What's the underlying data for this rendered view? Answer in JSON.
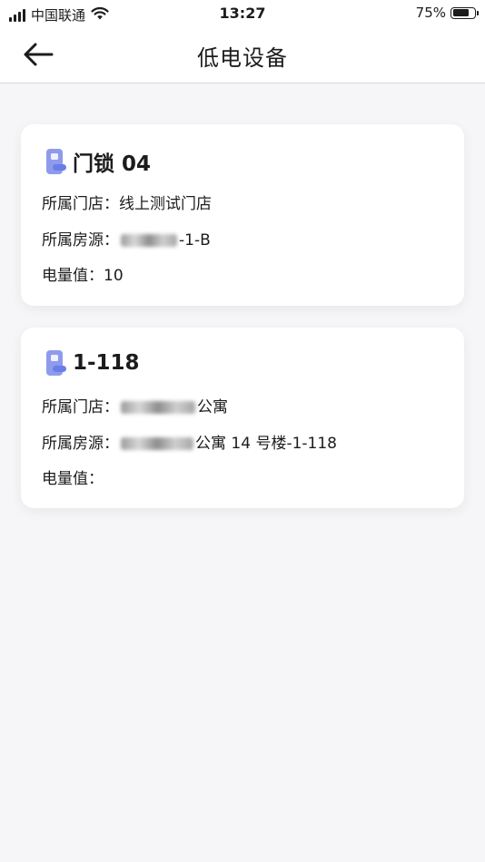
{
  "status": {
    "carrier": "中国联通",
    "time": "13:27",
    "battery": "75%",
    "battery_level": 0.75
  },
  "nav": {
    "title": "低电设备"
  },
  "devices": [
    {
      "name": "门锁 04",
      "store_label": "所属门店：",
      "store_value": "线上测试门店",
      "room_label": "所属房源：",
      "room_value": "-1-B",
      "battery_label": "电量值：",
      "battery_value": "10"
    },
    {
      "name": "1-118",
      "store_label": "所属门店：",
      "store_value": "公寓",
      "room_label": "所属房源：",
      "room_value": "公寓 14 号楼-1-118",
      "battery_label": "电量值：",
      "battery_value": ""
    }
  ],
  "colors": {
    "icon_primary": "#8e9bec",
    "icon_accent": "#6a7ee8",
    "background": "#f6f6f8"
  },
  "icons": {
    "back": "arrow-left-icon",
    "device": "door-lock-icon",
    "wifi": "wifi-icon",
    "signal": "signal-icon",
    "battery": "battery-icon"
  }
}
